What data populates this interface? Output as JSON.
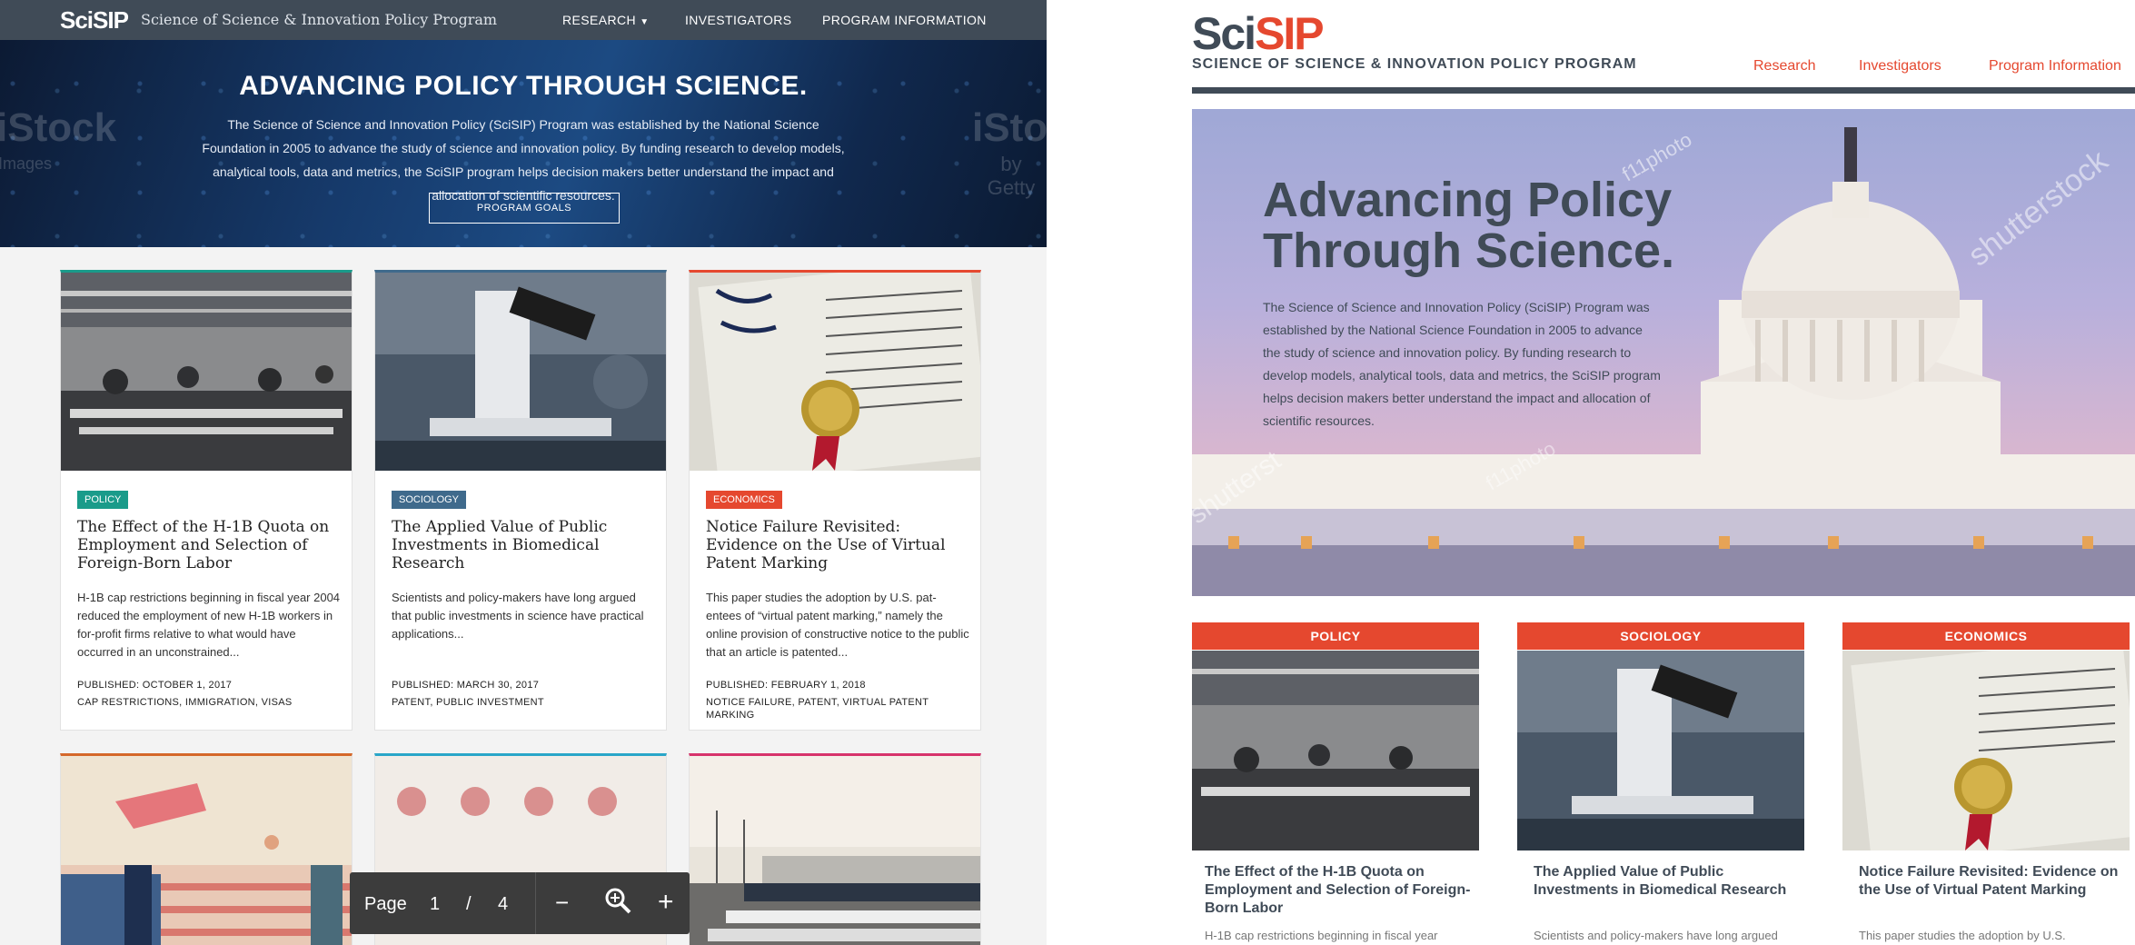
{
  "left": {
    "logo": "SciSIP",
    "tagline": "Science of Science & Innovation Policy Program",
    "nav": [
      "RESEARCH",
      "INVESTIGATORS",
      "PROGRAM INFORMATION"
    ],
    "hero_title": "ADVANCING POLICY THROUGH SCIENCE.",
    "hero_text": "The Science of Science and Innovation Policy (SciSIP) Program was established by the National Science Foundation in 2005 to advance the study of science and innovation policy. By funding research to develop models, analytical tools, data and metrics, the SciSIP program helps decision makers better understand the impact and allocation of scientific resources.",
    "goals_button": "PROGRAM GOALS",
    "watermark_left": "iStock",
    "watermark_left_sub": "Images",
    "watermark_right": "iSto",
    "watermark_right_sub": "by Getty",
    "cards": [
      {
        "tag": "POLICY",
        "tag_color": "#1a9b8a",
        "title": "The Effect of the H-1B Quota on Employment and Selection of Foreign-Born Labor",
        "excerpt": "H-1B cap restrictions beginning in fiscal year 2004 reduced the employment of new H-1B workers in for-profit firms relative to what would have occurred in an unconstrained...",
        "published": "PUBLISHED: OCTOBER 1, 2017",
        "keywords": "CAP RESTRICTIONS, IMMIGRATION, VISAS"
      },
      {
        "tag": "SOCIOLOGY",
        "tag_color": "#3f6a8c",
        "title": "The Applied Value of Public Investments in Biomedical Research",
        "excerpt": "Scientists and policy-makers have long argued that public investments in science have practical applications...",
        "published": "PUBLISHED: MARCH 30, 2017",
        "keywords": "PATENT, PUBLIC INVESTMENT"
      },
      {
        "tag": "ECONOMICS",
        "tag_color": "#e5482f",
        "title": "Notice Failure Revisited: Evidence on the Use of Virtual Patent Marking",
        "excerpt": "This paper studies the adoption by U.S. pat-entees of “virtual patent marking,” namely the online provision of constructive notice to the public that an article is patented...",
        "published": "PUBLISHED: FEBRUARY 1, 2018",
        "keywords": "NOTICE FAILURE, PATENT, VIRTUAL PATENT MARKING"
      }
    ],
    "pager": {
      "label": "Page",
      "current": "1",
      "sep": "/",
      "total": "4"
    }
  },
  "right": {
    "logo_a": "Sci",
    "logo_b": "SIP",
    "tagline": "SCIENCE OF SCIENCE & INNOVATION POLICY PROGRAM",
    "nav": [
      "Research",
      "Investigators",
      "Program Information"
    ],
    "hero_title": "Advancing Policy Through Science.",
    "hero_text": "The Science of Science and Innovation Policy (SciSIP) Program was established by the National Science Foundation in 2005 to advance the study of science and innovation policy. By funding research to develop models, analytical tools, data and metrics, the SciSIP program helps decision makers better understand the impact and allocation of scientific resources.",
    "watermarks": [
      "f11photo",
      "shutterstock",
      "shutterst",
      "f11photo"
    ],
    "cards": [
      {
        "category": "POLICY",
        "title": "The Effect of the H-1B Quota on Employment and Selection of Foreign-Born Labor",
        "cut": "H-1B cap restrictions beginning in fiscal year"
      },
      {
        "category": "SOCIOLOGY",
        "title": "The Applied Value of Public Investments in Biomedical Research",
        "cut": "Scientists and policy-makers have long argued"
      },
      {
        "category": "ECONOMICS",
        "title": "Notice Failure Revisited: Evidence on the Use of Virtual Patent Marking",
        "cut": "This paper studies the adoption by U.S."
      }
    ]
  },
  "colors": {
    "accent": "#e5482f",
    "navy": "#404b57",
    "teal": "#1a9b8a"
  }
}
